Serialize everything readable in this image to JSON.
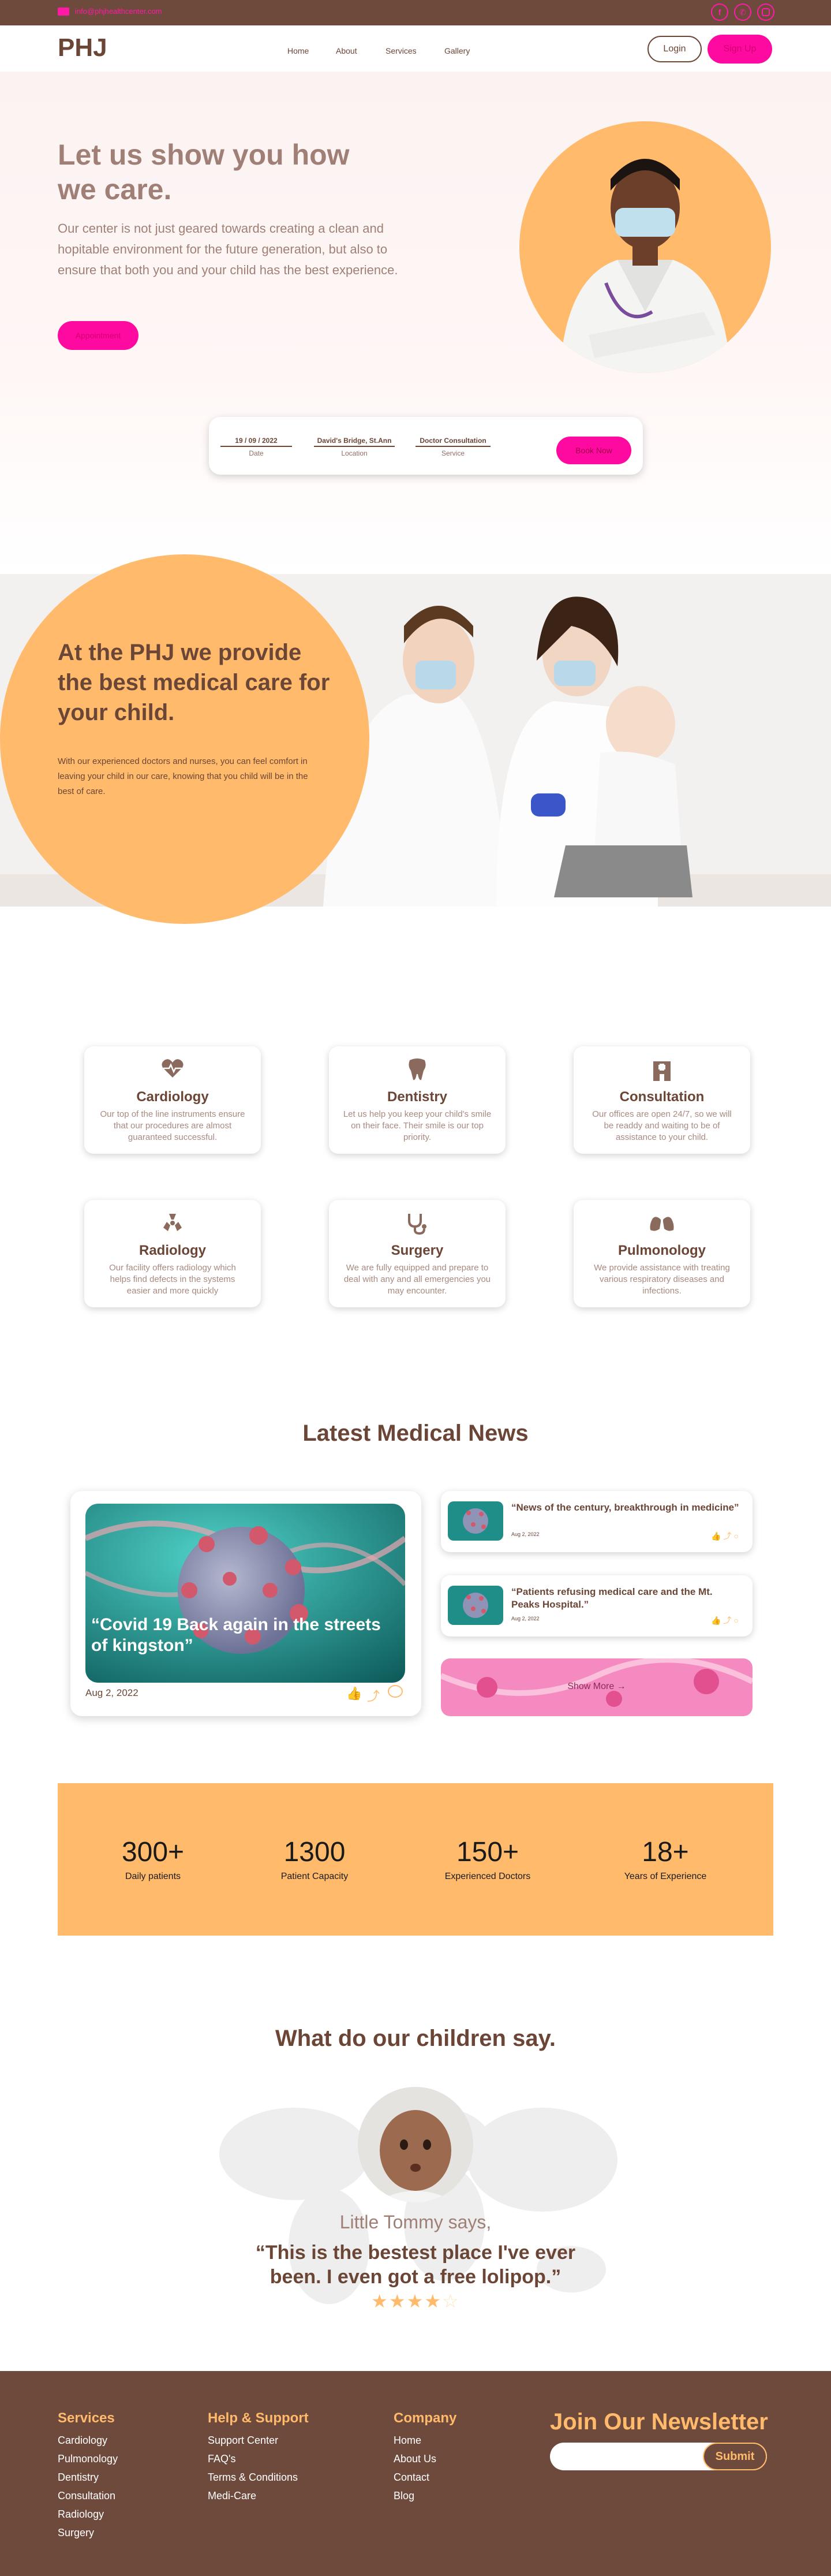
{
  "topbar": {
    "email": "info@phjhealthcenter.com",
    "social": [
      "facebook-icon",
      "phone-icon",
      "instagram-icon"
    ]
  },
  "nav": {
    "logo": "PHJ",
    "links": [
      "Home",
      "About",
      "Services",
      "Gallery"
    ],
    "login": "Login",
    "signup": "Sign Up"
  },
  "hero": {
    "title": "Let us show you how we care.",
    "body": "Our center is not just geared towards creating a clean and hopitable environment for the future generation, but also to ensure that both you and your child has the best experience.",
    "cta": "Appointment"
  },
  "booking": {
    "date": "19 / 09 / 2022",
    "date_label": "Date",
    "location": "David's Bridge, St.Ann",
    "location_label": "Location",
    "service": "Doctor Consultation",
    "service_label": "Service",
    "button": "Book Now"
  },
  "care": {
    "title": "At the PHJ we provide the best medical care for your child.",
    "body": "With our experienced doctors and  nurses,  you can feel comfort in leaving your child in our care, knowing that you child will be in the best of care."
  },
  "services": [
    {
      "icon": "heartbeat-icon",
      "title": "Cardiology",
      "desc": "Our top of the line instruments ensure that our procedures are almost guaranteed successful."
    },
    {
      "icon": "tooth-icon",
      "title": "Dentistry",
      "desc": "Let us help you keep your child's smile on their face. Their smile is our top priority."
    },
    {
      "icon": "hospital-icon",
      "title": "Consultation",
      "desc": "Our offices are open 24/7, so we will be readdy and waiting to be of assistance to your child."
    },
    {
      "icon": "radiation-icon",
      "title": "Radiology",
      "desc": "Our facility offers radiology which helps find defects in the systems easier and more quickly"
    },
    {
      "icon": "stethoscope-icon",
      "title": "Surgery",
      "desc": "We are fully equipped and prepare to deal with any and all emergencies you may encounter."
    },
    {
      "icon": "lungs-icon",
      "title": "Pulmonology",
      "desc": "We provide assistance with treating various respiratory diseases and infections."
    }
  ],
  "news": {
    "heading": "Latest Medical News",
    "main": {
      "title": "“Covid 19 Back again in the streets of kingston”",
      "date": "Aug 2, 2022"
    },
    "items": [
      {
        "title": "“News of the century,  breakthrough in medicine”",
        "date": "Aug 2, 2022"
      },
      {
        "title": "“Patients refusing medical care and the Mt. Peaks Hospital.”",
        "date": "Aug 2, 2022"
      }
    ],
    "more": "Show More →"
  },
  "stats": [
    {
      "value": "300+",
      "label": "Daily patients"
    },
    {
      "value": "1300",
      "label": "Patient Capacity"
    },
    {
      "value": "150+",
      "label": "Experienced Doctors"
    },
    {
      "value": "18+",
      "label": "Years of Experience"
    }
  ],
  "testimonial": {
    "heading": "What do our children say.",
    "name": "Little Tommy says,",
    "quote": "“This is the bestest place I've ever been. I even got a free lolipop.”",
    "rating": 4,
    "max": 5
  },
  "footer": {
    "services": {
      "title": "Services",
      "items": [
        "Cardiology",
        "Pulmonology",
        "Dentistry",
        "Consultation",
        "Radiology",
        "Surgery"
      ]
    },
    "help": {
      "title": "Help & Support",
      "items": [
        "Support Center",
        "FAQ's",
        "Terms & Conditions",
        "Medi-Care"
      ]
    },
    "company": {
      "title": "Company",
      "items": [
        "Home",
        "About Us",
        "Contact",
        "Blog"
      ]
    },
    "newsletter": {
      "title": "Join Our Newsletter",
      "button": "Submit",
      "placeholder": ""
    }
  },
  "colors": {
    "brown": "#6e4a3d",
    "orange": "#ffba6b",
    "pink": "#ff0aa0"
  }
}
